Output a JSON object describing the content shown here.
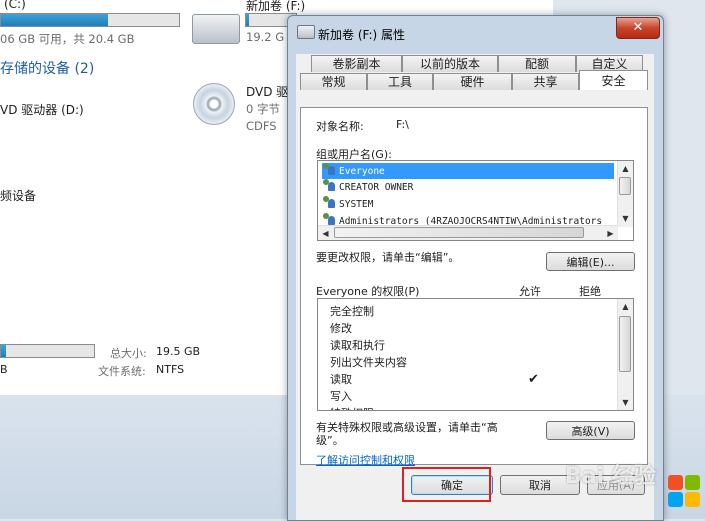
{
  "explorer": {
    "drive_c": {
      "title": "(C:)",
      "size_text": "06 GB 可用，共 20.4 GB",
      "fill_fraction": 0.6
    },
    "drive_f": {
      "title": "新加卷 (F:)",
      "size_text": "19.2 G",
      "fill_fraction": 0.05
    },
    "removable_heading": "存储的设备 (2)",
    "dvd_d": "VD 驱动器 (D:)",
    "dvd2": {
      "title": "DVD 驱",
      "line1": "0 字节",
      "line2": "CDFS"
    },
    "other_device": "频设备",
    "details": {
      "total_size_label": "总大小:",
      "total_size_value": "19.5 GB",
      "fs_label": "文件系统:",
      "fs_value": "NTFS",
      "left_text": "B",
      "fill_fraction": 0.05
    }
  },
  "dialog": {
    "title": "新加卷 (F:) 属性",
    "close_glyph": "✕",
    "tabs_row1": [
      "卷影副本",
      "以前的版本",
      "配额",
      "自定义"
    ],
    "tabs_row2": [
      "常规",
      "工具",
      "硬件",
      "共享",
      "安全"
    ],
    "active_tab": "安全",
    "object_name_label": "对象名称:",
    "object_name_value": "F:\\",
    "group_label": "组或用户名(G):",
    "users": [
      "Everyone",
      "CREATOR OWNER",
      "SYSTEM",
      "Administrators (4RZAOJOCRS4NTIW\\Administrators"
    ],
    "selected_user": "Everyone",
    "change_text": "要更改权限，请单击“编辑”。",
    "edit_button": "编辑(E)...",
    "perm_header": "Everyone 的权限(P)",
    "allow_header": "允许",
    "deny_header": "拒绝",
    "permissions": [
      {
        "name": "完全控制",
        "allow": "",
        "deny": ""
      },
      {
        "name": "修改",
        "allow": "",
        "deny": ""
      },
      {
        "name": "读取和执行",
        "allow": "",
        "deny": ""
      },
      {
        "name": "列出文件夹内容",
        "allow": "",
        "deny": ""
      },
      {
        "name": "读取",
        "allow": "✔",
        "deny": ""
      },
      {
        "name": "写入",
        "allow": "",
        "deny": ""
      },
      {
        "name": "特殊权限",
        "allow": "",
        "deny": ""
      }
    ],
    "special_text_1": "有关特殊权限或高级设置，请单击“高",
    "special_text_2": "级”。",
    "advanced_button": "高级(V)",
    "link_text": "了解访问控制和权限",
    "ok_button": "确定",
    "cancel_button": "取消",
    "apply_button": "应用(A)"
  },
  "watermark": "Bai 经验",
  "colors": {
    "selection": "#3399ff",
    "highlight": "#e02020",
    "link": "#0066cc",
    "bar_fill": "#2a8fca"
  }
}
